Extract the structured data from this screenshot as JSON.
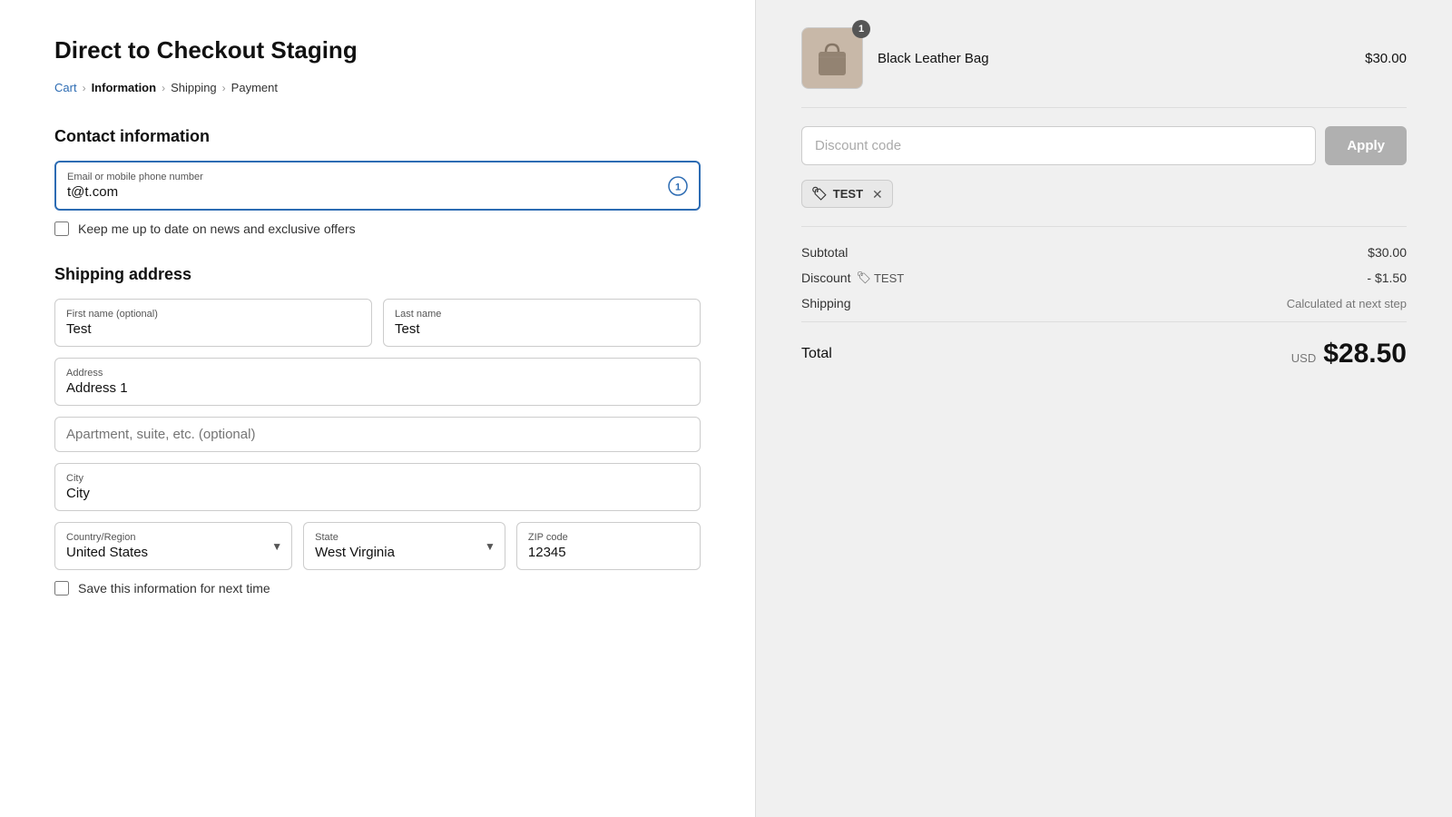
{
  "page": {
    "title": "Direct to Checkout Staging"
  },
  "breadcrumb": {
    "items": [
      "Cart",
      "Information",
      "Shipping",
      "Payment"
    ],
    "current_index": 1
  },
  "contact": {
    "section_title": "Contact information",
    "email_label": "Email or mobile phone number",
    "email_value": "t@t.com",
    "newsletter_label": "Keep me up to date on news and exclusive offers"
  },
  "shipping": {
    "section_title": "Shipping address",
    "first_name_label": "First name (optional)",
    "first_name_value": "Test",
    "last_name_label": "Last name",
    "last_name_value": "Test",
    "address_label": "Address",
    "address_value": "Address 1",
    "address2_placeholder": "Apartment, suite, etc. (optional)",
    "city_label": "City",
    "city_value": "City",
    "country_label": "Country/Region",
    "country_value": "United States",
    "state_label": "State",
    "state_value": "West Virginia",
    "zip_label": "ZIP code",
    "zip_value": "12345",
    "save_label": "Save this information for next time"
  },
  "order": {
    "product_name": "Black Leather Bag",
    "product_price": "$30.00",
    "product_qty_badge": "1",
    "discount_placeholder": "Discount code",
    "apply_label": "Apply",
    "discount_tag_name": "TEST",
    "subtotal_label": "Subtotal",
    "subtotal_value": "$30.00",
    "discount_label": "Discount",
    "discount_code_tag": "TEST",
    "discount_value": "- $1.50",
    "shipping_label": "Shipping",
    "shipping_value": "Calculated at next step",
    "total_label": "Total",
    "total_currency": "USD",
    "total_amount": "$28.50"
  }
}
